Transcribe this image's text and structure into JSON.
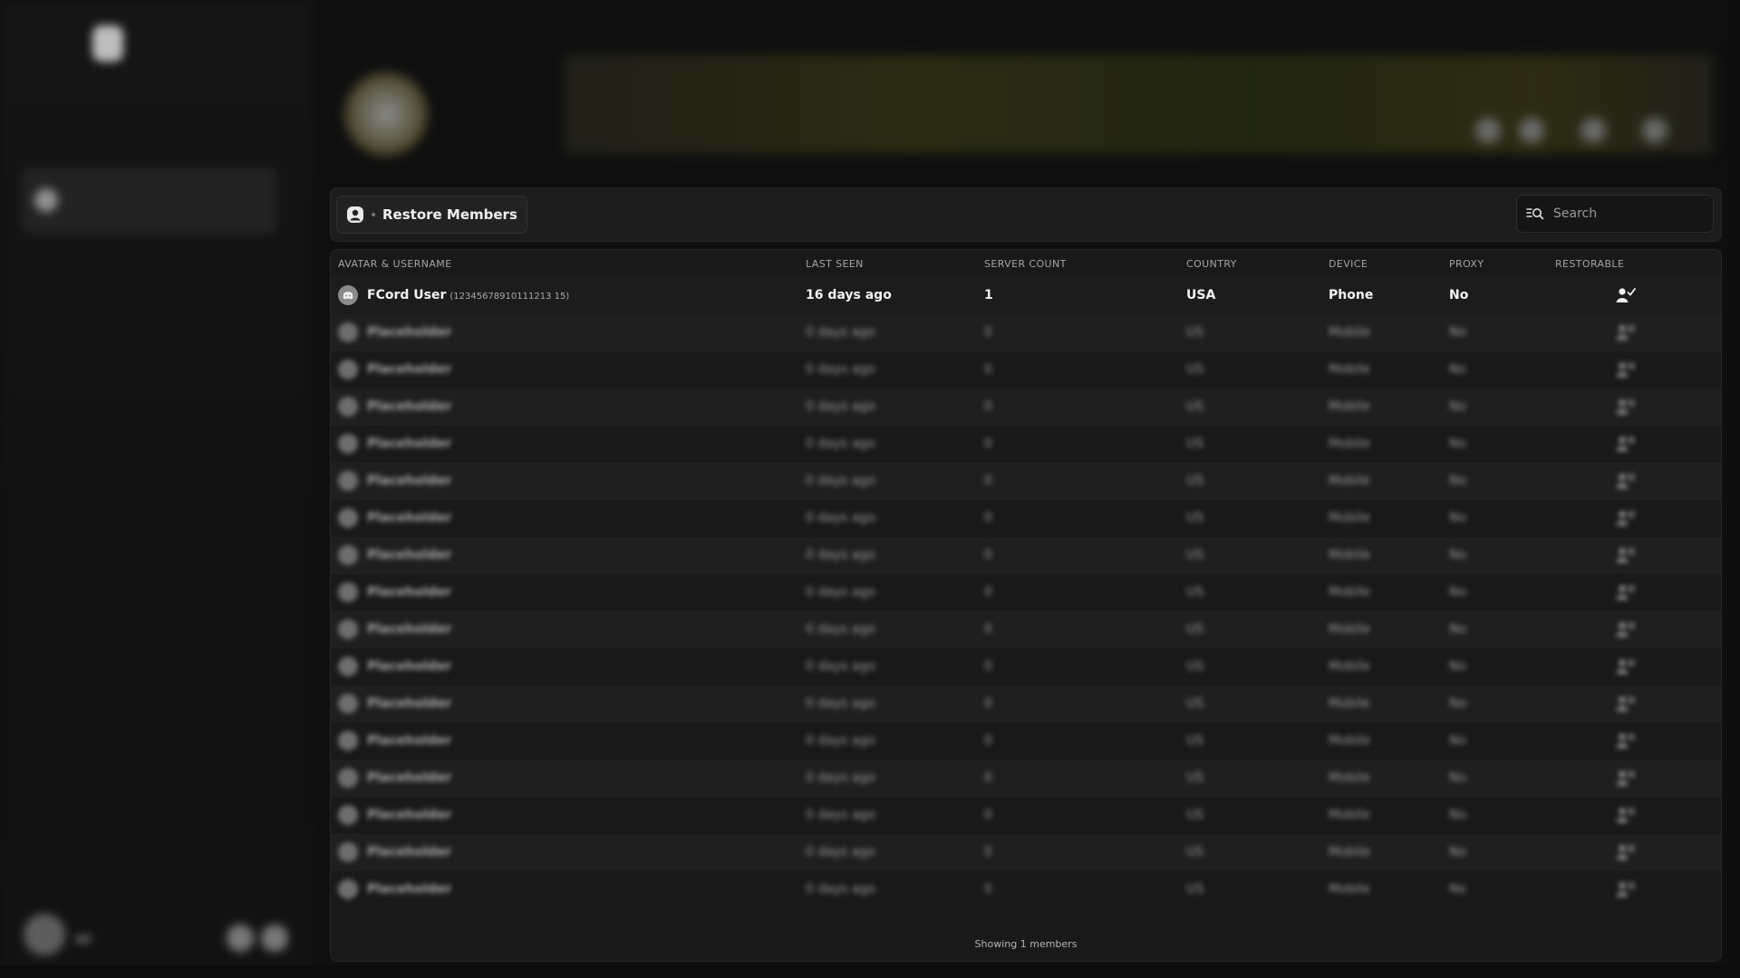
{
  "toolbar": {
    "tab_label": "Restore Members",
    "search_placeholder": "Search"
  },
  "table": {
    "columns": [
      "AVATAR & USERNAME",
      "LAST SEEN",
      "SERVER COUNT",
      "COUNTRY",
      "DEVICE",
      "PROXY",
      "RESTORABLE"
    ],
    "member": {
      "username": "FCord User",
      "user_id": "(12345678910111213 15)",
      "last_seen": "16 days ago",
      "server_count": "1",
      "country": "USA",
      "device": "Phone",
      "proxy": "No",
      "restorable_icon": "user-check-icon"
    },
    "placeholder_row": {
      "username": "Placeholder",
      "last_seen": "0 days ago",
      "server_count": "0",
      "country": "US",
      "device": "Mobile",
      "proxy": "No",
      "restorable_icon": "user-x-icon"
    },
    "placeholder_count": 16
  },
  "footer": {
    "count_text": "Showing 1 members"
  },
  "colors": {
    "background": "#0f0f0f",
    "panel": "#191919",
    "row_alt": "#1f1f1f",
    "text": "#f3f3f3",
    "muted": "#a5a5a5"
  }
}
